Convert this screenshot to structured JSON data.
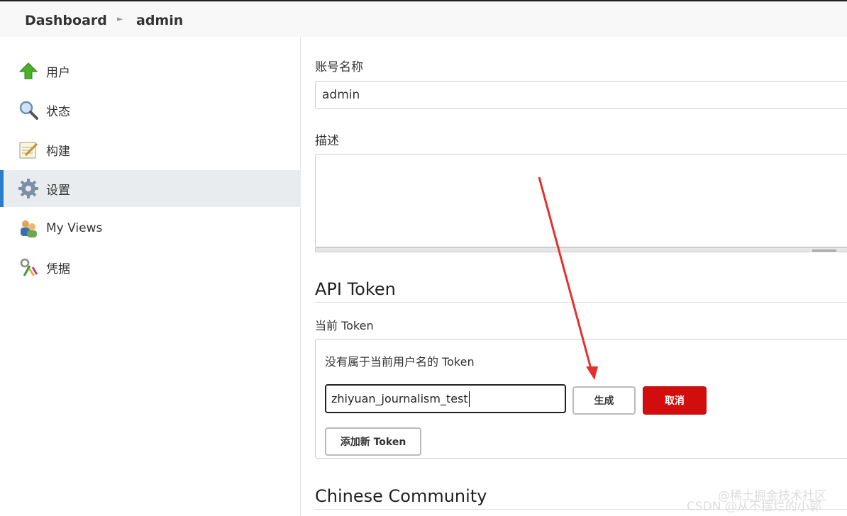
{
  "breadcrumb": {
    "home": "Dashboard",
    "separator": "›",
    "current": "admin"
  },
  "sidebar": {
    "items": [
      {
        "label": "用户",
        "icon": "up-arrow-icon",
        "active": false
      },
      {
        "label": "状态",
        "icon": "magnifier-icon",
        "active": false
      },
      {
        "label": "构建",
        "icon": "notepad-icon",
        "active": false
      },
      {
        "label": "设置",
        "icon": "gear-icon",
        "active": true
      },
      {
        "label": "My Views",
        "icon": "users-icon",
        "active": false
      },
      {
        "label": "凭据",
        "icon": "keys-icon",
        "active": false
      }
    ]
  },
  "form": {
    "account_label": "账号名称",
    "account_value": "admin",
    "description_label": "描述",
    "description_value": ""
  },
  "api_token": {
    "title": "API Token",
    "current_label": "当前 Token",
    "none_text": "没有属于当前用户名的 Token",
    "input_value": "zhiyuan_journalism_test",
    "generate_label": "生成",
    "cancel_label": "取消",
    "add_label": "添加新 Token"
  },
  "next_section": {
    "title": "Chinese Community"
  },
  "watermarks": {
    "top": "@稀土掘金技术社区",
    "bottom": "CSDN @从不摆烂的小郭"
  },
  "colors": {
    "accent": "#2a7bc9",
    "danger": "#d20d0d",
    "arrow": "#e53030"
  }
}
